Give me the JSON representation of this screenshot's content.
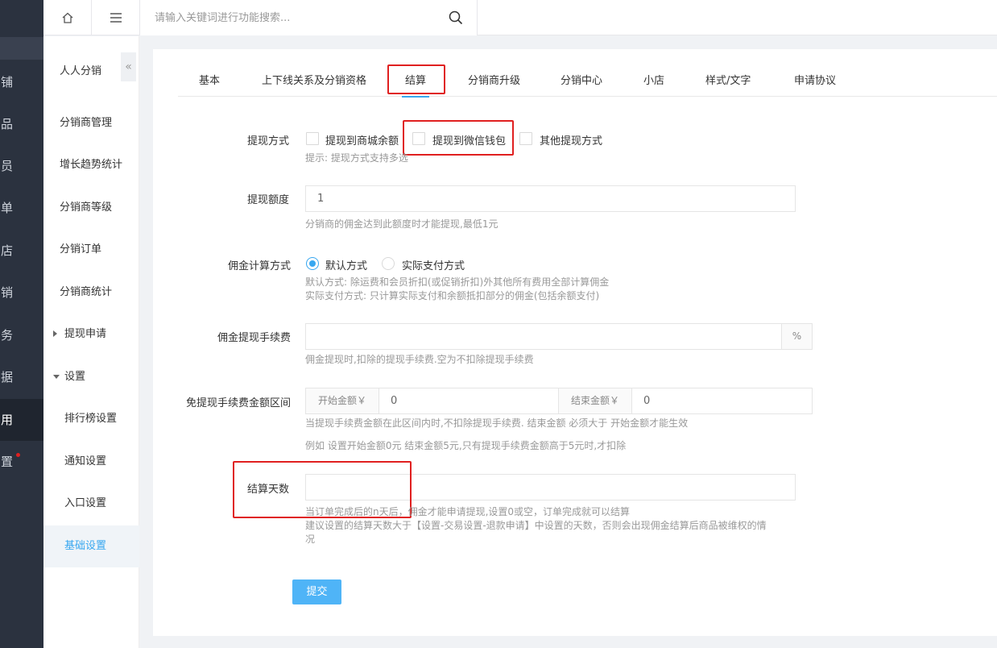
{
  "dark_nav": {
    "items": [
      "铺",
      "品",
      "员",
      "单",
      "店",
      "销",
      "务",
      "据",
      "用",
      "置"
    ]
  },
  "topbar": {
    "search_placeholder": "请输入关键词进行功能搜索..."
  },
  "subnav": {
    "title": "人人分销",
    "collapse_label": "«",
    "items": [
      "分销商管理",
      "增长趋势统计",
      "分销商等级",
      "分销订单",
      "分销商统计"
    ],
    "withdraw_group": "提现申请",
    "settings_group": "设置",
    "settings_children": [
      "排行榜设置",
      "通知设置",
      "入口设置",
      "基础设置"
    ]
  },
  "tabs": [
    "基本",
    "上下线关系及分销资格",
    "结算",
    "分销商升级",
    "分销中心",
    "小店",
    "样式/文字",
    "申请协议"
  ],
  "active_tab": "结算",
  "form": {
    "withdraw_method": {
      "label": "提现方式",
      "options": [
        "提现到商城余额",
        "提现到微信钱包",
        "其他提现方式"
      ],
      "hint": "提示: 提现方式支持多选"
    },
    "withdraw_amount": {
      "label": "提现额度",
      "value": "1",
      "hint": "分销商的佣金达到此额度时才能提现,最低1元"
    },
    "commission_calc": {
      "label": "佣金计算方式",
      "options": [
        "默认方式",
        "实际支付方式"
      ],
      "selected": "默认方式",
      "hint1": "默认方式: 除运费和会员折扣(或促销折扣)外其他所有费用全部计算佣金",
      "hint2": "实际支付方式: 只计算实际支付和余额抵扣部分的佣金(包括余额支付)"
    },
    "withdraw_fee": {
      "label": "佣金提现手续费",
      "value": "",
      "unit": "%",
      "hint": "佣金提现时,扣除的提现手续费.空为不扣除提现手续费"
    },
    "fee_free_range": {
      "label": "免提现手续费金额区间",
      "start_label": "开始金额￥",
      "start_value": "0",
      "end_label": "结束金额￥",
      "end_value": "0",
      "hint1": "当提现手续费金额在此区间内时,不扣除提现手续费. 结束金额 必须大于 开始金额才能生效",
      "hint2": "例如 设置开始金额0元 结束金额5元,只有提现手续费金额高于5元时,才扣除"
    },
    "settle_days": {
      "label": "结算天数",
      "value": "",
      "hint1": "当订单完成后的n天后，佣金才能申请提现,设置0或空，订单完成就可以结算",
      "hint2": "建议设置的结算天数大于【设置-交易设置-退款申请】中设置的天数，否则会出现佣金结算后商品被维权的情",
      "hint3": "况"
    },
    "submit_label": "提交"
  },
  "colors": {
    "accent": "#38a7f0",
    "highlight_box": "#e02020",
    "dark_nav": "#2b323f"
  }
}
